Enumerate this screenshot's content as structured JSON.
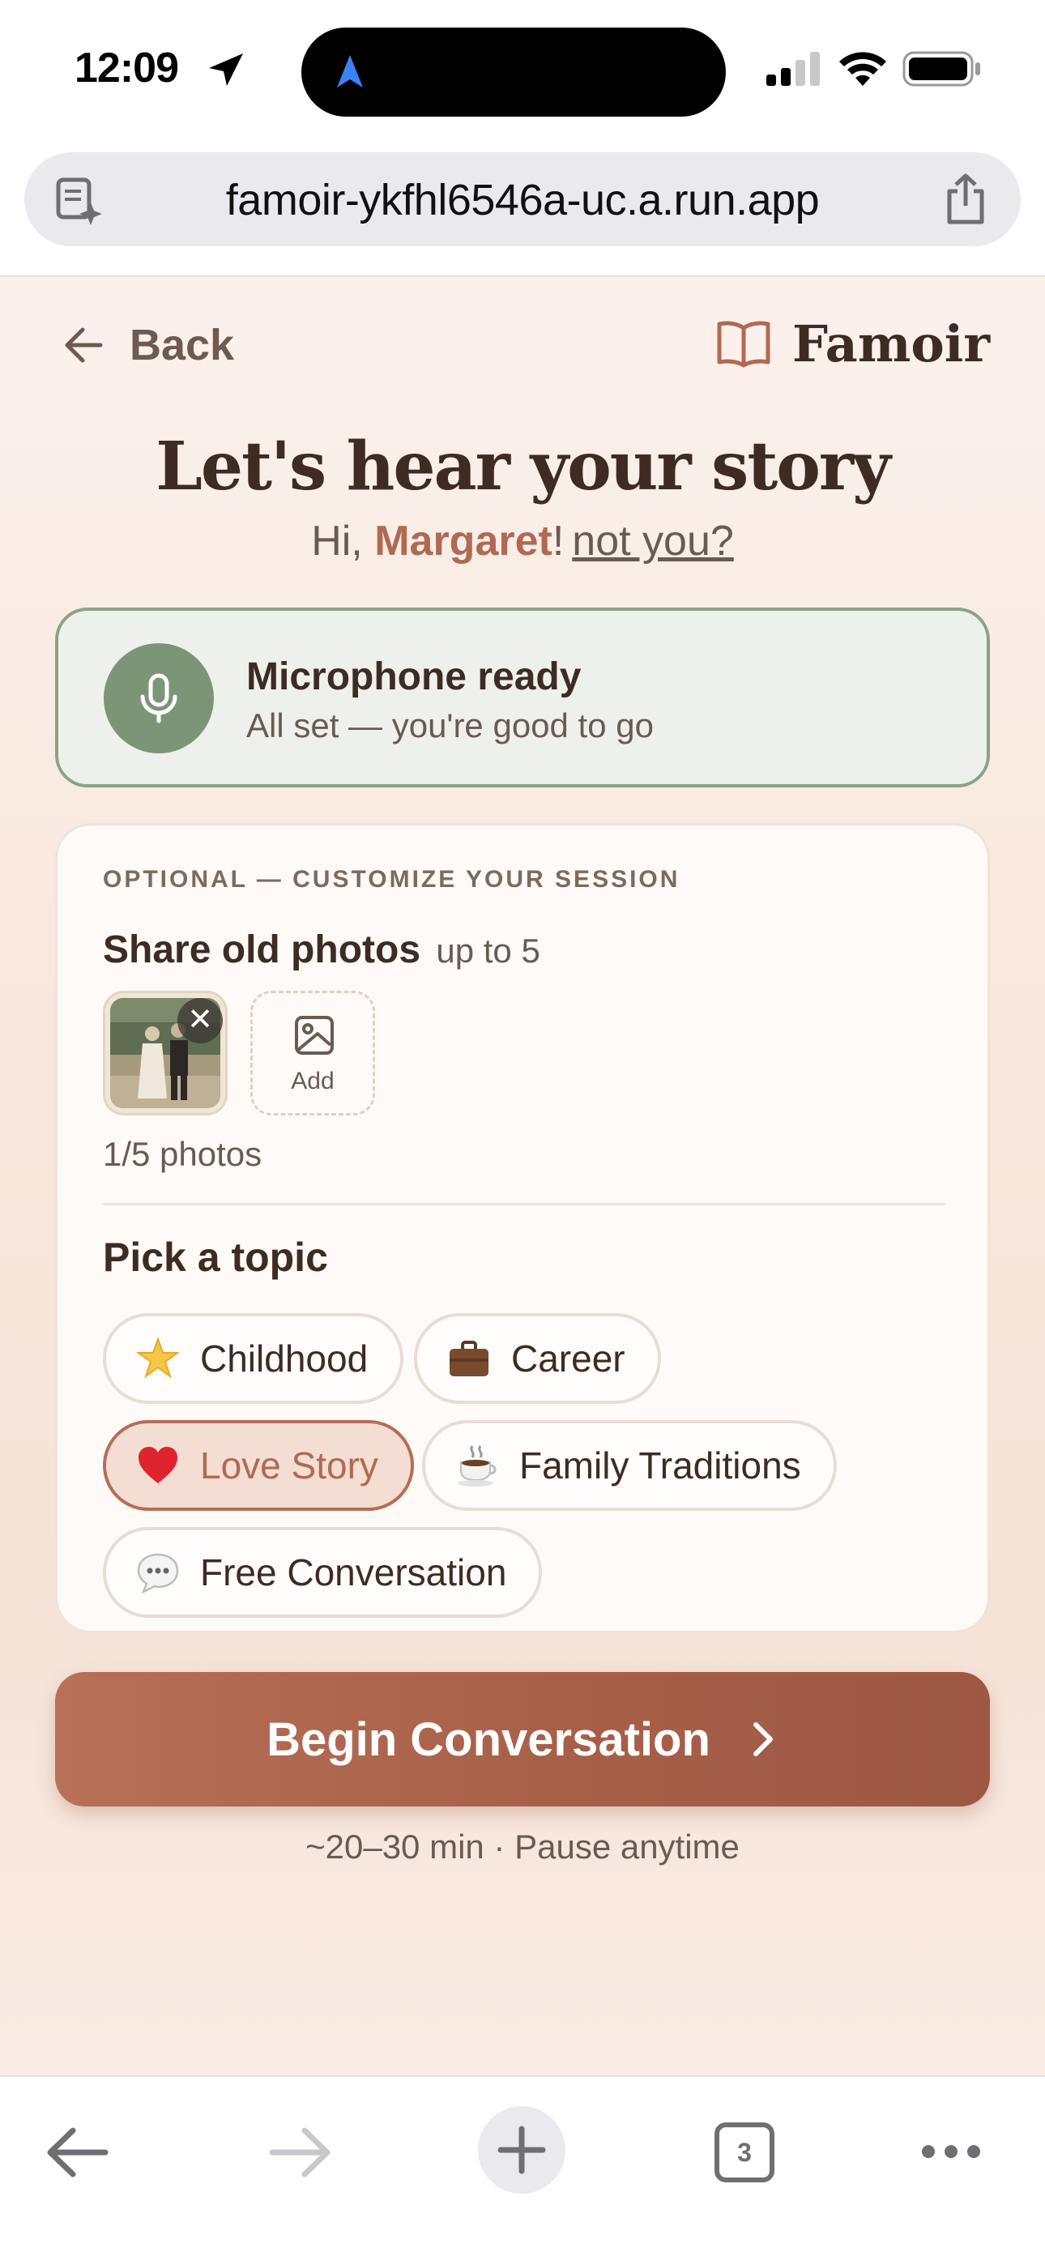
{
  "status_bar": {
    "time": "12:09",
    "icons": [
      "location-arrow-icon",
      "cellular-signal-icon",
      "wifi-icon",
      "battery-icon"
    ]
  },
  "browser": {
    "url": "famoir-ykfhl6546a-uc.a.run.app",
    "tab_count": "3",
    "icons": [
      "reader-mode-icon",
      "share-icon",
      "back-arrow-icon",
      "forward-arrow-icon",
      "new-tab-plus-icon",
      "tabs-icon",
      "more-icon"
    ]
  },
  "header": {
    "back_label": "Back",
    "brand_name": "Famoir"
  },
  "hero": {
    "title": "Let's hear your story",
    "greeting_prefix": "Hi, ",
    "user_name": "Margaret",
    "greeting_suffix": "!",
    "not_you_label": "not you?"
  },
  "mic_status": {
    "title": "Microphone ready",
    "subtitle": "All set — you're good to go"
  },
  "customize": {
    "caption": "OPTIONAL — CUSTOMIZE YOUR SESSION",
    "photos_heading": "Share old photos",
    "photos_limit": "up to 5",
    "add_label": "Add",
    "photo_count": "1/5 photos",
    "topic_heading": "Pick a topic",
    "topics": [
      {
        "label": "Childhood",
        "icon": "star-emoji",
        "selected": false
      },
      {
        "label": "Career",
        "icon": "briefcase-emoji",
        "selected": false
      },
      {
        "label": "Love Story",
        "icon": "heart-emoji",
        "selected": true
      },
      {
        "label": "Family Traditions",
        "icon": "coffee-emoji",
        "selected": false
      },
      {
        "label": "Free Conversation",
        "icon": "speech-bubble-emoji",
        "selected": false
      }
    ]
  },
  "cta": {
    "label": "Begin Conversation",
    "note": "~20–30 min · Pause anytime"
  },
  "colors": {
    "accent": "#b06a52",
    "cta_start": "#b87058",
    "cta_end": "#9d5843",
    "mic_green": "#7c9577",
    "text_dark": "#3d2b24"
  }
}
